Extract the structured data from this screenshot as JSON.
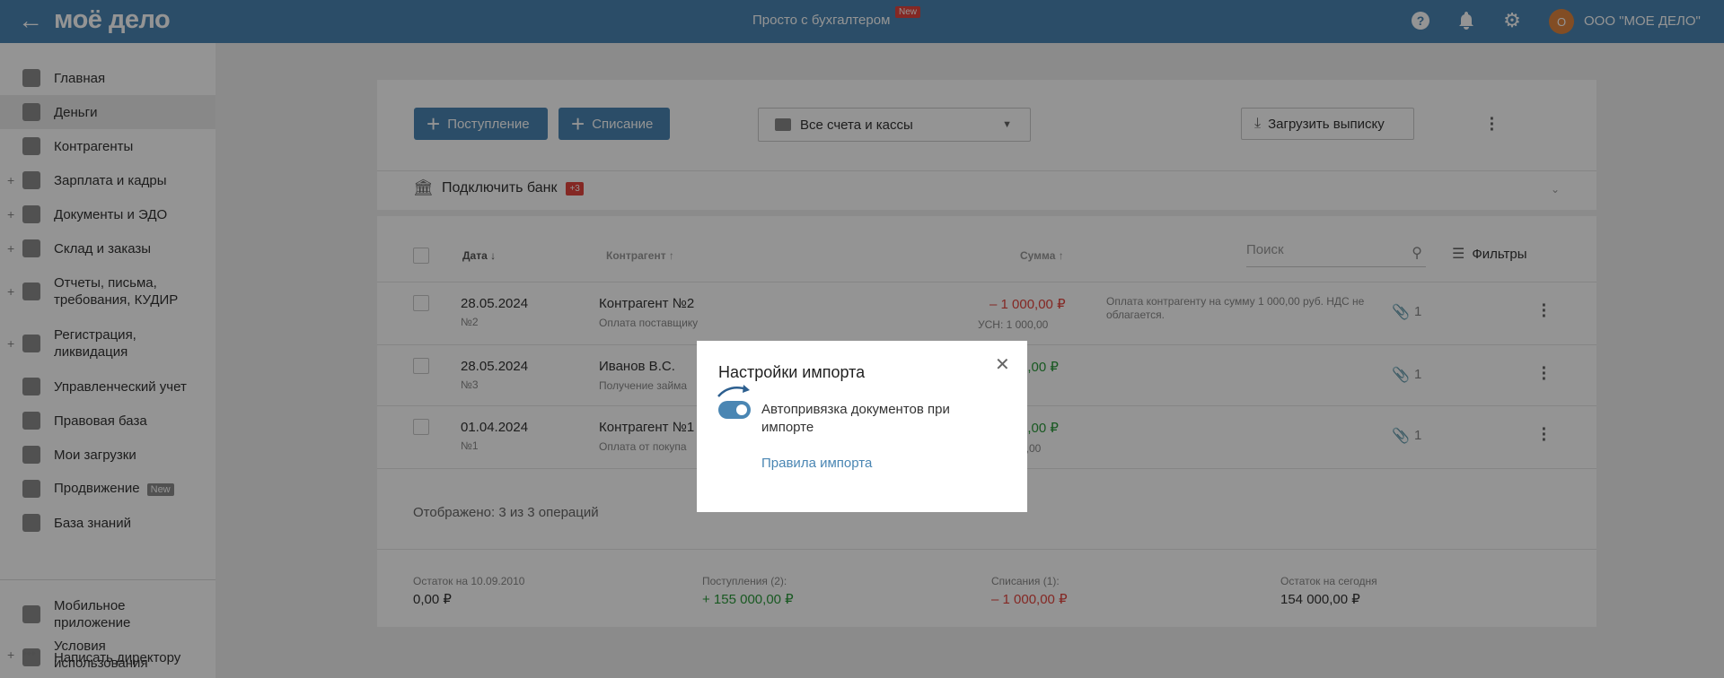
{
  "topbar": {
    "logo": "моё дело",
    "center_text": "Просто с бухгалтером",
    "new_badge": "New",
    "avatar_letter": "О",
    "company": "ООО \"МОЕ ДЕЛО\""
  },
  "sidebar": {
    "items": [
      {
        "label": "Главная"
      },
      {
        "label": "Деньги"
      },
      {
        "label": "Контрагенты"
      },
      {
        "label": "Зарплата и кадры"
      },
      {
        "label": "Документы и ЭДО"
      },
      {
        "label": "Склад и заказы"
      },
      {
        "label": "Отчеты, письма, требования, КУДИР"
      },
      {
        "label": "Регистрация, ликвидация"
      },
      {
        "label": "Управленческий учет"
      },
      {
        "label": "Правовая база"
      },
      {
        "label": "Мои загрузки"
      },
      {
        "label": "Продвижение",
        "tag": "New"
      },
      {
        "label": "База знаний"
      },
      {
        "label": "Мобильное приложение"
      },
      {
        "label": "Написать директору"
      },
      {
        "label": "Условия использования"
      }
    ]
  },
  "toolbar": {
    "income_label": "Поступление",
    "expense_label": "Списание",
    "account_select": "Все счета и кассы",
    "upload_label": "Загрузить выписку"
  },
  "bank": {
    "label": "Подключить банк",
    "count": "+3"
  },
  "table": {
    "headers": {
      "date": "Дата ↓",
      "contractor": "Контрагент ↑",
      "sum": "Сумма ↑"
    },
    "search_placeholder": "Поиск",
    "filters_label": "Фильтры",
    "rows": [
      {
        "date": "28.05.2024",
        "num": "№2",
        "contractor": "Контрагент №2",
        "purpose": "Оплата поставщику",
        "sum": "– 1 000,00 ₽",
        "tax": "УСН: 1 000,00",
        "description": "Оплата контрагенту на сумму 1 000,00 руб. НДС не облагается.",
        "docs": "1"
      },
      {
        "date": "28.05.2024",
        "num": "№3",
        "contractor": "Иванов В.С.",
        "purpose": "Получение займа",
        "sum": "0,00 ₽",
        "docs": "1"
      },
      {
        "date": "01.04.2024",
        "num": "№1",
        "contractor": "Контрагент №1",
        "purpose": "Оплата от покупа",
        "sum": "0,00 ₽",
        "tax": "0,00",
        "docs": "1"
      }
    ],
    "shown": "Отображено: 3 из 3 операций"
  },
  "summary": {
    "balance_start_label": "Остаток на 10.09.2010",
    "balance_start": "0,00 ₽",
    "income_label": "Поступления (2):",
    "income": "+ 155 000,00 ₽",
    "expense_label": "Списания (1):",
    "expense": "– 1 000,00 ₽",
    "balance_today_label": "Остаток на сегодня",
    "balance_today": "154 000,00 ₽"
  },
  "modal": {
    "title": "Настройки импорта",
    "toggle_label": "Автопривязка документов при импорте",
    "toggle_on": true,
    "link": "Правила импорта"
  },
  "colors": {
    "brand": "#4a86b3",
    "negative": "#e3463f",
    "positive": "#2b9a3b"
  }
}
